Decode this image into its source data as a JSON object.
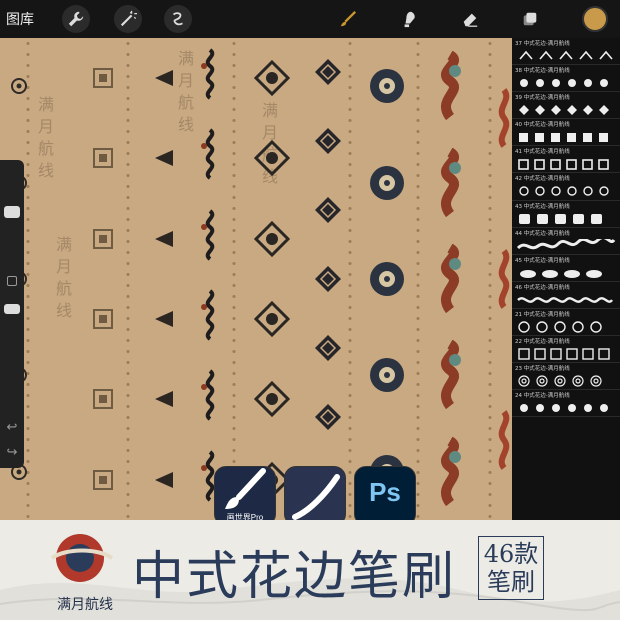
{
  "toolbar": {
    "gallery_label": "图库",
    "tools": [
      "wrench-icon",
      "magic-wand-icon",
      "selection-icon",
      "brush-icon",
      "smudge-icon",
      "eraser-icon",
      "layers-icon"
    ],
    "current_color": "#c89a4a"
  },
  "canvas": {
    "background": "#c8a982",
    "watermarks": [
      {
        "text": "满月航线"
      },
      {
        "text": "满月航线"
      },
      {
        "text": "满月航线"
      },
      {
        "text": "满月航线"
      }
    ]
  },
  "brush_library": {
    "items": [
      {
        "label": "37 中式花边-满月航线"
      },
      {
        "label": "38 中式花边-满月航线"
      },
      {
        "label": "39 中式花边-满月航线"
      },
      {
        "label": "40 中式花边-满月航线"
      },
      {
        "label": "41 中式花边-满月航线"
      },
      {
        "label": "42 中式花边-满月航线"
      },
      {
        "label": "43 中式花边-满月航线"
      },
      {
        "label": "44 中式花边-满月航线"
      },
      {
        "label": "45 中式花边-满月航线"
      },
      {
        "label": "46 中式花边-满月航线"
      },
      {
        "label": "21 中式花边-满月航线"
      },
      {
        "label": "22 中式花边-满月航线"
      },
      {
        "label": "23 中式花边-满月航线"
      },
      {
        "label": "24 中式花边-满月航线"
      }
    ]
  },
  "apps": {
    "procreate_label": "画世界Pro",
    "ps_label": "Ps"
  },
  "banner": {
    "logo_text": "满月航线",
    "title": "中式花边笔刷",
    "count_line1": "46款",
    "count_line2": "笔刷"
  }
}
